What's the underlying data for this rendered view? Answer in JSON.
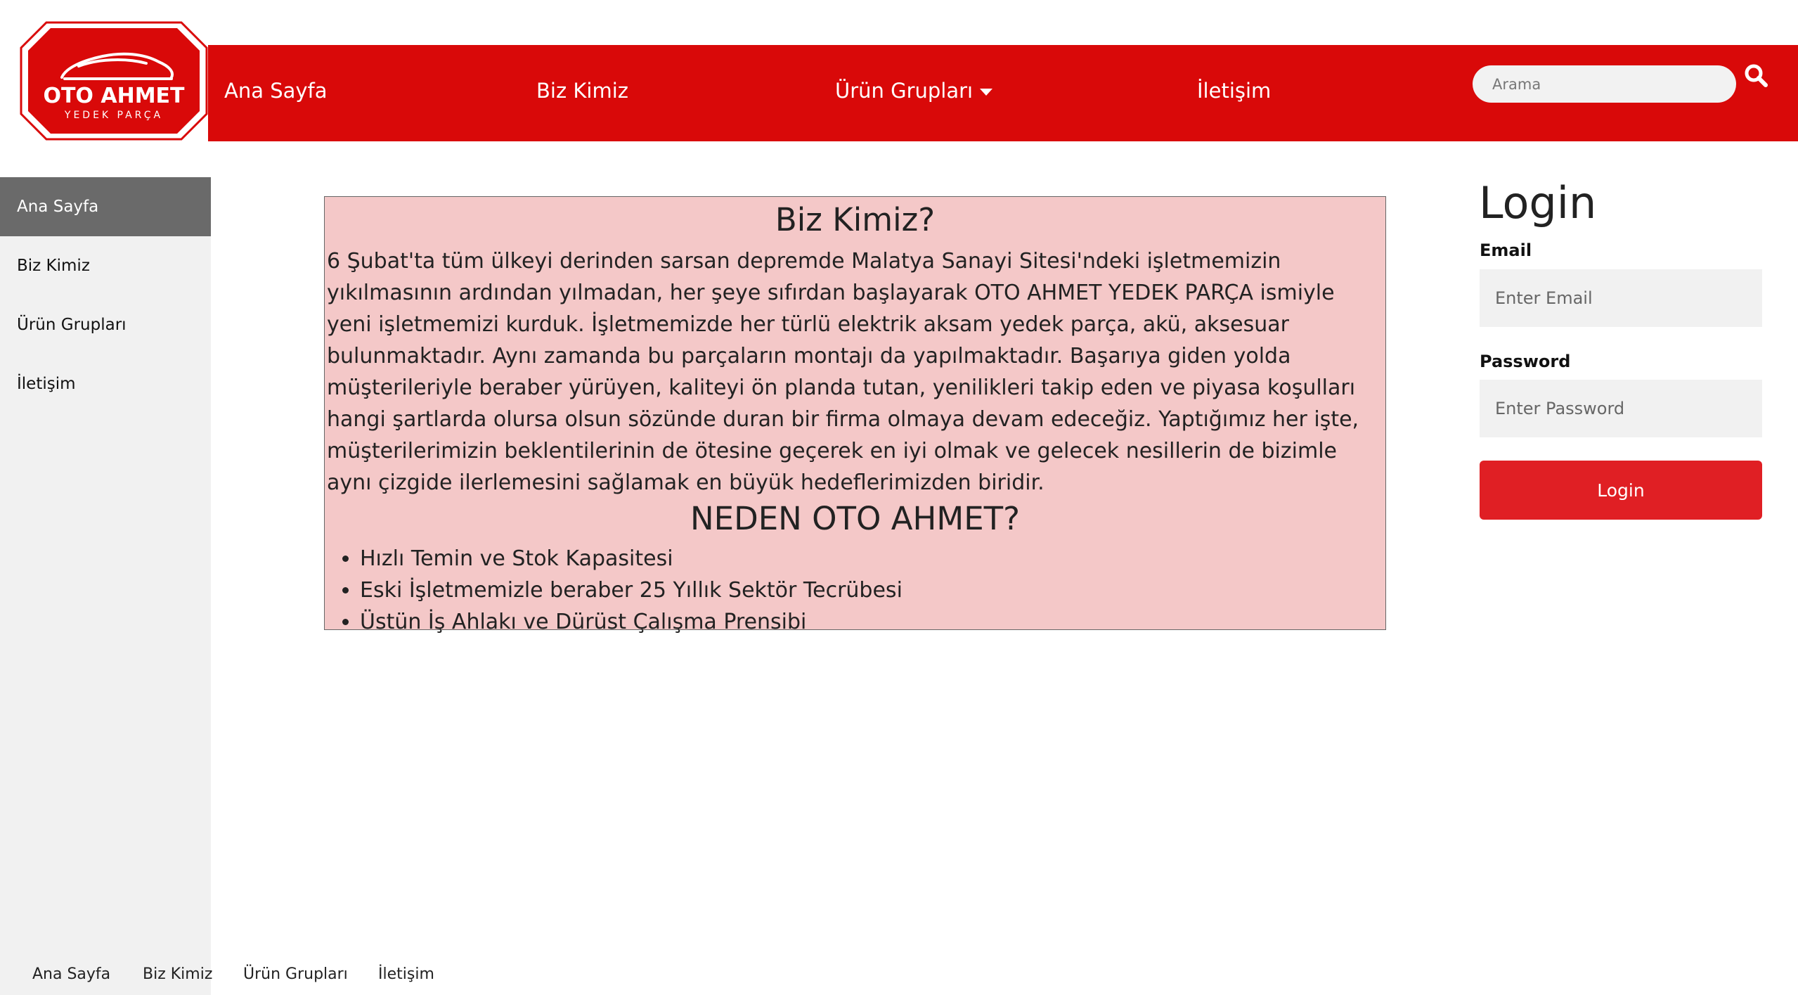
{
  "brand": {
    "name_line1": "OTO AHMET",
    "name_line2": "YEDEK PARÇA",
    "color_primary": "#d90909",
    "color_button": "#e01f24"
  },
  "nav": {
    "items": [
      {
        "label": "Ana Sayfa"
      },
      {
        "label": "Biz Kimiz"
      },
      {
        "label": "Ürün Grupları",
        "has_dropdown": true
      },
      {
        "label": "İletişim"
      }
    ],
    "search": {
      "placeholder": "Arama",
      "icon": "search-icon"
    }
  },
  "sidebar": {
    "items": [
      {
        "label": "Ana Sayfa",
        "active": true
      },
      {
        "label": "Biz Kimiz"
      },
      {
        "label": "Ürün Grupları"
      },
      {
        "label": "İletişim"
      }
    ]
  },
  "content": {
    "title": "Biz Kimiz?",
    "paragraph": "6 Şubat'ta tüm ülkeyi derinden sarsan depremde Malatya Sanayi Sitesi'ndeki işletmemizin yıkılmasının ardından yılmadan, her şeye sıfırdan başlayarak OTO AHMET YEDEK PARÇA ismiyle yeni işletmemizi kurduk. İşletmemizde her türlü elektrik aksam yedek parça, akü, aksesuar bulunmaktadır. Aynı zamanda bu parçaların montajı da yapılmaktadır. Başarıya giden yolda müşterileriyle beraber yürüyen, kaliteyi ön planda tutan, yenilikleri takip eden ve piyasa koşulları hangi şartlarda olursa olsun sözünde duran bir firma olmaya devam edeceğiz. Yaptığımız her işte, müşterilerimizin beklentilerinin de ötesine geçerek en iyi olmak ve gelecek nesillerin de bizimle aynı çizgide ilerlemesini sağlamak en büyük hedeflerimizden biridir.",
    "subtitle": "NEDEN OTO AHMET?",
    "reasons": [
      "Hızlı Temin ve Stok Kapasitesi",
      "Eski İşletmemizle beraber 25 Yıllık Sektör Tecrübesi",
      "Üstün İş Ahlakı ve Dürüst Çalışma Prensibi"
    ]
  },
  "login": {
    "title": "Login",
    "email_label": "Email",
    "email_placeholder": "Enter Email",
    "password_label": "Password",
    "password_placeholder": "Enter Password",
    "button_label": "Login"
  },
  "footer": {
    "links": [
      {
        "label": "Ana Sayfa"
      },
      {
        "label": "Biz Kimiz"
      },
      {
        "label": "Ürün Grupları"
      },
      {
        "label": "İletişim"
      }
    ]
  }
}
